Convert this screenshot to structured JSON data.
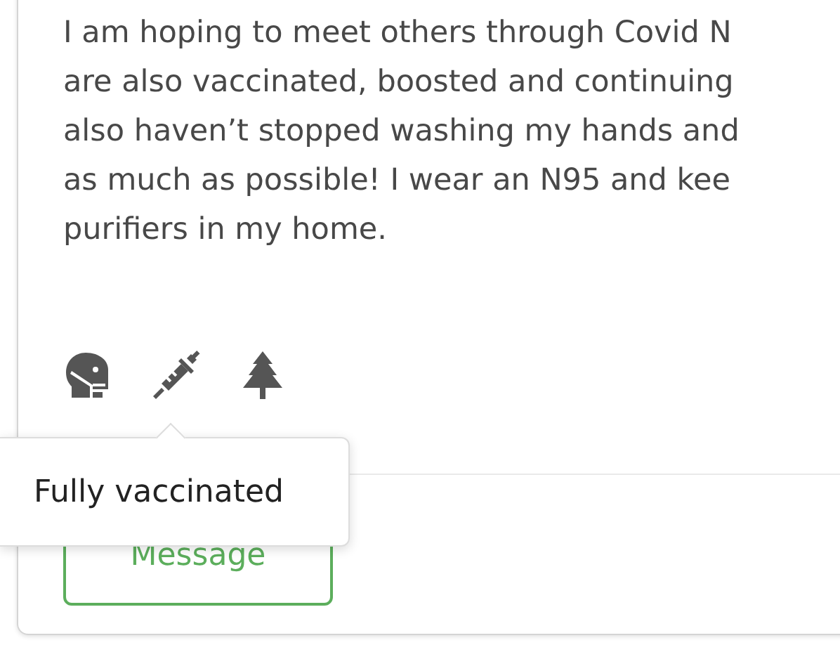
{
  "post": {
    "text": "I am hoping to meet others through Covid N\nare also vaccinated, boosted and continuing\nalso haven’t stopped washing my hands and\nas much as possible! I wear an N95 and kee\npurifiers in my home.",
    "badges": [
      {
        "kind": "mask"
      },
      {
        "kind": "syringe",
        "tooltip": "Fully vaccinated"
      },
      {
        "kind": "tree"
      }
    ],
    "button": "Message"
  }
}
